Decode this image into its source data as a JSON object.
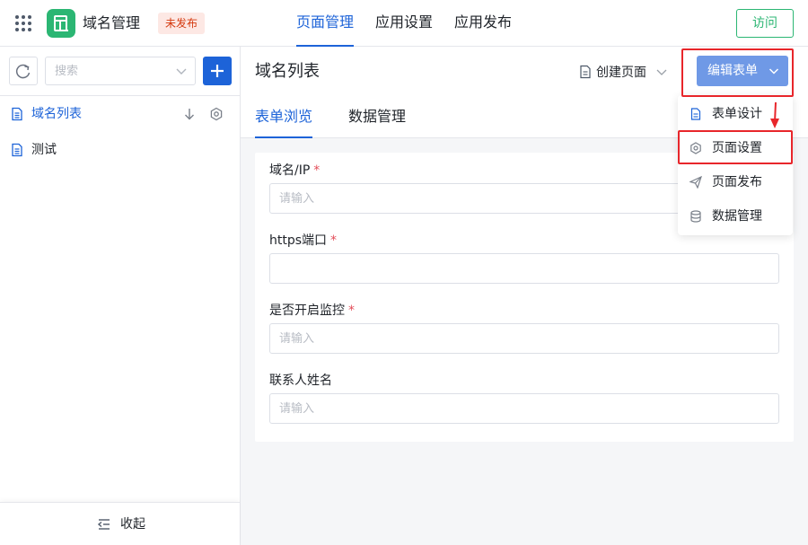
{
  "app": {
    "name": "域名管理",
    "status": "未发布",
    "logo_color": "#2bb673"
  },
  "top_nav": {
    "tabs": [
      "页面管理",
      "应用设置",
      "应用发布"
    ],
    "active": 0
  },
  "visit_button": "访问",
  "sidebar": {
    "search_placeholder": "搜索",
    "items": [
      {
        "label": "域名列表",
        "active": true
      },
      {
        "label": "测试",
        "active": false
      }
    ],
    "collapse_label": "收起"
  },
  "main": {
    "title": "域名列表",
    "create_page_label": "创建页面",
    "edit_form_button": "编辑表单",
    "tabs": [
      "表单浏览",
      "数据管理"
    ],
    "active_tab": 0,
    "form": {
      "fields": [
        {
          "label": "域名/IP",
          "required": true,
          "placeholder": "请输入"
        },
        {
          "label": "https端口",
          "required": true,
          "placeholder": ""
        },
        {
          "label": "是否开启监控",
          "required": true,
          "placeholder": "请输入"
        },
        {
          "label": "联系人姓名",
          "required": false,
          "placeholder": "请输入"
        }
      ]
    }
  },
  "dropdown_menu": {
    "items": [
      {
        "label": "表单设计",
        "icon": "document-icon"
      },
      {
        "label": "页面设置",
        "icon": "gear-icon"
      },
      {
        "label": "页面发布",
        "icon": "send-icon"
      },
      {
        "label": "数据管理",
        "icon": "database-icon"
      }
    ]
  },
  "colors": {
    "accent": "#1d63d8",
    "highlight": "#e8262b",
    "edit_button": "#6f99e6"
  }
}
